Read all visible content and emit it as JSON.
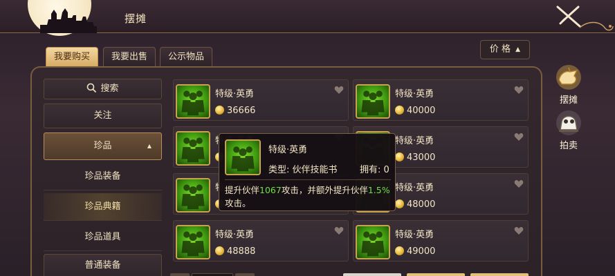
{
  "header": {
    "title": "摆摊"
  },
  "tabs": [
    {
      "label": "我要购买",
      "active": true
    },
    {
      "label": "我要出售",
      "active": false
    },
    {
      "label": "公示物品",
      "active": false
    }
  ],
  "sort": {
    "label": "价 格",
    "icon": "caret-up-icon"
  },
  "sidebar": {
    "search_label": "搜索",
    "follow_label": "关注",
    "category_label": "珍品",
    "sub_items": [
      {
        "label": "珍品装备",
        "selected": false
      },
      {
        "label": "珍品典籍",
        "selected": true
      },
      {
        "label": "珍品道具",
        "selected": false
      }
    ],
    "general_label": "普通装备"
  },
  "items": [
    {
      "name": "特级·英勇",
      "price": "36666"
    },
    {
      "name": "特级·英勇",
      "price": "40000"
    },
    {
      "name": "特级·英勇",
      "price": ""
    },
    {
      "name": "特级·英勇",
      "price": "43000"
    },
    {
      "name": "特级·英勇",
      "price": ""
    },
    {
      "name": "特级·英勇",
      "price": "48000"
    },
    {
      "name": "特级·英勇",
      "price": "48888"
    },
    {
      "name": "特级·英勇",
      "price": "49000"
    }
  ],
  "tooltip": {
    "name": "特级·英勇",
    "type": "类型: 伙伴技能书",
    "owned": "拥有: 0",
    "desc_part1": "提升伙伴",
    "desc_value1": "1067",
    "desc_part2": "攻击，并额外提升伙伴",
    "desc_value2": "1.5%",
    "desc_part3": "攻击。"
  },
  "right_nav": [
    {
      "label": "摆摊",
      "icon": "stall-icon"
    },
    {
      "label": "拍卖",
      "icon": "auction-icon"
    }
  ],
  "colors": {
    "accent_gold": "#d7ac66",
    "highlight_green": "#6fe04a",
    "panel_border": "#7a5c3e"
  }
}
